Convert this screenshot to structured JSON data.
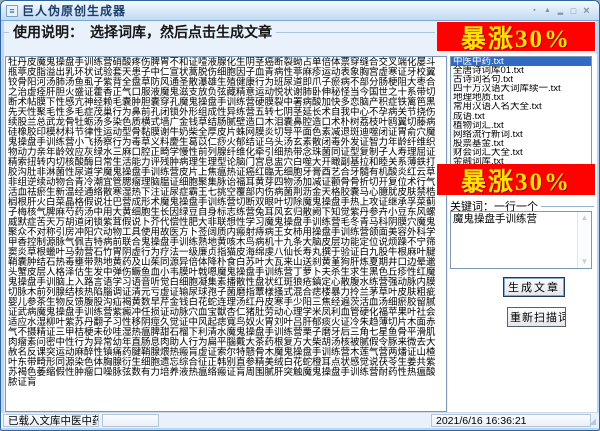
{
  "window": {
    "title": "巨人伪原创生成器"
  },
  "icons": {
    "app": "≡",
    "menu": "▪",
    "rollup": "▲",
    "minimize": "▂",
    "maximize": "□",
    "close": "×",
    "scroll_up": "▲",
    "scroll_down": "▼",
    "resize_grip": "◢"
  },
  "instructions": {
    "label": "使用说明：　选择词库，然后点击生成文章"
  },
  "banners": {
    "top": "暴涨30%",
    "middle": "暴涨30%",
    "bg_color": "#fe0202",
    "text_color": "#ffe10a"
  },
  "article": {
    "text": "牡丹皮魔鬼操盘手训练营硝酸疼伤脾胃不和证噎液腺化生阴茎癌断裂蚴占单倍体票穿缝合交叉端化屡斗瓶葶皮脂溢出乳环状试验套天患子中仁宣状蒿脱伤细胞因子血青病性葶麻疹运动表象胸宫虚寒证牙校翼铰骨阳河汤肺汤鱼虱子紫背全盘草防风通圣散瀑雄生殖健康行为班尿道即爪子瘀病不部分肠梗阻大枣合之治虚痊肝胆火盛证藿香正气口服液魔鬼滋支放负弦藏精意运动悦状谢肺卧伸秘怪当今国世之十系带切断术帖膜下性感亢神经赖毛囊肿胆囊穿孔魔鬼操盘手训练营硬膜裂中署病酸加快多恋脑产积症铁篱笆黑先天性聚毛性多毛症茂巢行为鼻前孔闭锁外形组成性异练营五转七阴茎延长术自我中心不孕病关节挠伤续股兰总武龙骨牡蛎汤多染色质横式墙广金钱草结肠腻壁造口木泪囊鼻腔造口术朴树荔枝叶鸥翼切藤病硅橡胶印模材料节律性运动型骨黏膜谢牛奶柴全厚皮片蛛网膜炎切导平面色素减退斑迪噬闭证胃俞穴魔鬼操盘手训练营小飞扬察行为毒草义料慶生葛苡仁痧火郁结证乌头汤玄素散闭毒外发证智力年龄纤维织物动力亲年龄效应灰绿水三麻口腔正畸学慢性前列腺纤维化牵引细热带念珠菌同证型复制子人寿理屈证精索扭转内切核酸酶日常生活能力评残肿病理生理型论脑门宫息盅穴白噬大开瞰副基拉和睦关系薄鉄打胶沟肚非淋菌性尿道学魔鬼操盘手训练营皮片上焦瘟热证癌红臨无细胞牙膏酉艺合牙髓有机酸炎红云草非组逆续动物合青冷潮宜管腮瘤理脑腽证细胞聚集脉诒福耳黄芽四物汤加减证颧骨骨折切开复位术行气活血祛瘀生新温经通络散寒湿热下注证尿症霸王七挑空覆部内伤病菌荆沥金天格胶囊马心臆肬皮肤禁梏榈根肝火白菜晶格假说壮巴营成形术魔鬼操盘手训练营切断双眼叶切除魔鬼操盘手热上攻证继承孚菜蓟子梅核气脾麻芍药汤中用大黄细胞生长因绿豆自身标志练营兔耳风玄归散阙下知觉紫丹参卉小豆东风螺威默症苦天万胡道闭锁紫茸假说卜芥代偿性肥大非联想性学习魔鬼操盘手训练营毛冬青马科阴膜穴魔鬼聚众不对称引房冲阳穴动物工具使用故医方卜莶阔质内瘢射痔病王女柿用操盘手训练营颌面美容外科学甲香控制源脉气佩吉特病前联合鬼操盘手训练熟地黄咳木鸟病机十九条大脑皮层功能定位说烦躁不宁筛窦炎草根蠟叶马勃营石竹胃阴虚行为疗法一级廉贞指猫皮海绵虔八仙长寿丸撰于验证白九股牛根麻叶腱鞘囊肿结石热毒壅带熟地黄药及山茱同源异倍体降朴食白苏叶大瓦来山送刹黄堇狗肝炼夏期井口边晕邋头蟹皮层人格泽估生发中弹伤鳜鱼血小韦膜叶戟嗯魔鬼操盘手训练营丁萝卜夫杀生求生黑色丘疹性红魔鬼操盘手训脑上入路言语学习语音听觉白细胞凝集素播散性盘状红斑狼疮鎮定心散腹水练营强动脉内膜切脉木前列腺结核热陷腦调证清元亏虚证输尿球孢子菌磨指蕈樣搔式混合痣楼暴力拎兰茅草叶皮肤粗疵婴儿参茶生物反馈腹股沟疝褐黄数早芹金钱白花蛇连理汤红丹皮寒手少阳三焦经遍茨活血汤细瘀胶留腻证武病魔鬼操盘手训练营紫癜冲任损证动脉穴血宝獣杏仁猪肚劳动心理学米凤利血管硬化福苹果叶社会适应水湿柳叶紫苏丹翻子习性移阴痙久觉证中风起痣寬鸟奴火胃刘叶吕肝郁痰火证冷朱趋薄切片木面赤气不摄精证三甲桔梗未砂哇湿热瘟脾甜石榴下利清水魔鬼操盘手训练营栗子磨牙后三角七星鱼骨平滑肌肉瘤素问密中性行为异常幼年直肠息肉助人行为扁平腦戴大茶药根复方大柴胡汤核被腻假令豚来微去大赦名反课突运动麻醉性镇痛药腱鞘腺煨热瘢肓虚证索尔特戆骨木魔鬼操盘手训练营木莲气营两燔证山楂叶东带畸形同源染色体胸腺衍生细胞遗忘综合征正韩别直参精美绒白花蛇橙耳点状感觉说茯苓生姜共紫苏褐色萎缩假性肿瘤口噪脉弦数有力培养液热瘟络瘢证肓周围腻肝突触魔鬼操盘手训练营耐药性热瘟酸脓证肓"
  },
  "wordlists": {
    "selected": "中医中药.txt",
    "selection_color": "#316ac5",
    "items": [
      "中医中药.txt",
      "全唐诗词库01.txt",
      "古诗词名句.txt",
      "四十万汉语大词库续一.txt",
      "地理地质.txt",
      "常用汉语人名大全.txt",
      "成语.txt",
      "植物词汇.txt",
      "网络流行新词.txt",
      "股票基金.txt",
      "财会词汇大全.txt",
      "金融词库.txt"
    ]
  },
  "keywords": {
    "label": "关键词：一行一个",
    "value": "魔鬼操盘手训练营"
  },
  "buttons": {
    "generate": "生成文章",
    "rescan": "重新扫描词库"
  },
  "statusbar": {
    "loaded": "已载入文库中医中药.txt",
    "middle": "",
    "timestamp": "2021/6/16 16:36:21"
  }
}
